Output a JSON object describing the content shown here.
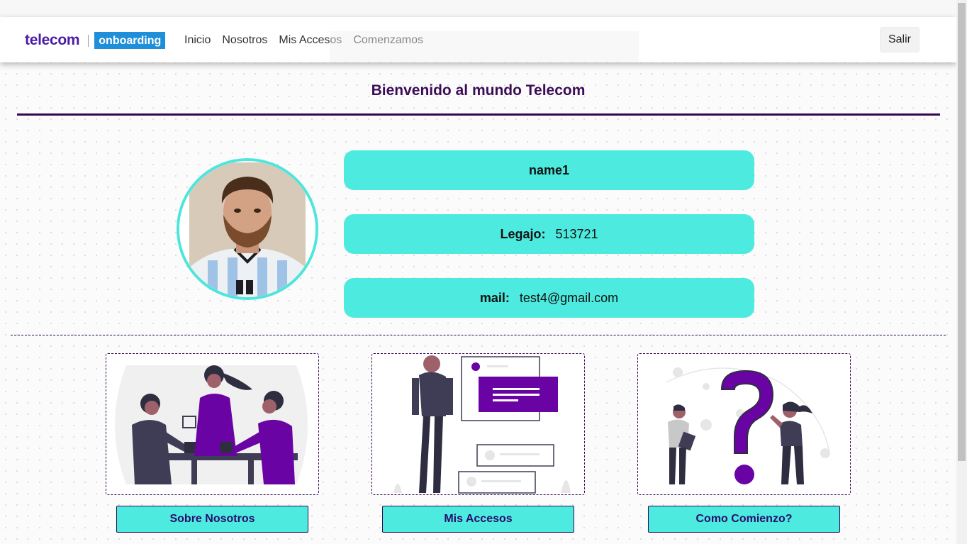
{
  "header": {
    "brand_name": "telecom",
    "brand_badge": "onboarding",
    "nav": [
      {
        "label": "Inicio"
      },
      {
        "label": "Nosotros"
      },
      {
        "label": "Mis Accesos"
      },
      {
        "label": "Comenzamos"
      }
    ],
    "logout_label": "Salir"
  },
  "page": {
    "title": "Bienvenido al mundo Telecom"
  },
  "profile": {
    "name": "name1",
    "legajo_label": "Legajo:",
    "legajo_value": "513721",
    "mail_label": "mail:",
    "mail_value": "test4@gmail.com"
  },
  "cards": [
    {
      "button_label": "Sobre Nosotros",
      "illustration": "team-meeting-illustration"
    },
    {
      "button_label": "Mis Accesos",
      "illustration": "access-windows-illustration"
    },
    {
      "button_label": "Como Comienzo?",
      "illustration": "question-mark-illustration"
    }
  ],
  "colors": {
    "brand_purple": "#4b1aa6",
    "dark_purple": "#35074f",
    "accent_purple": "#6a03a3",
    "turquoise": "#4debdf",
    "badge_blue": "#1e8fd8"
  }
}
